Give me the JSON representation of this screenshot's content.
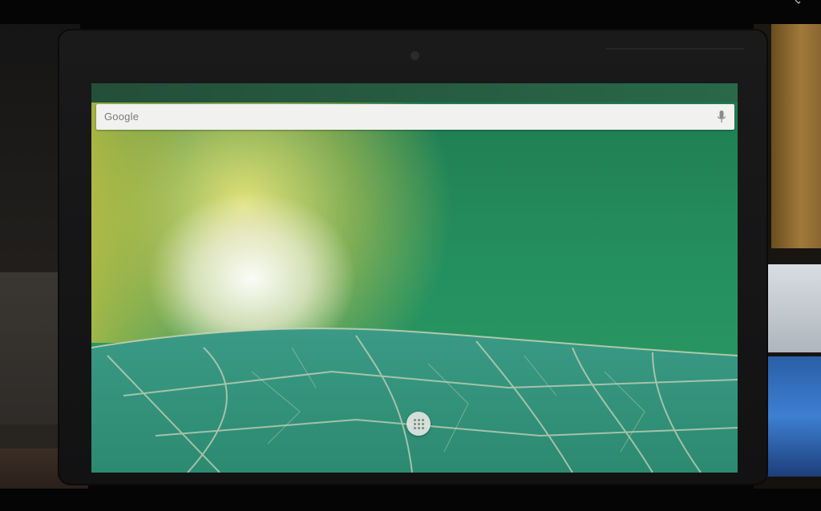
{
  "search": {
    "logo_text": "Google",
    "mic_icon": "microphone-icon"
  },
  "app_drawer": {
    "icon": "apps-grid-icon"
  },
  "colors": {
    "search_bar_bg": "#f1f1ef",
    "wallpaper_green": "#25905f",
    "wallpaper_glow": "#e6e27a",
    "bezel": "#151516"
  }
}
